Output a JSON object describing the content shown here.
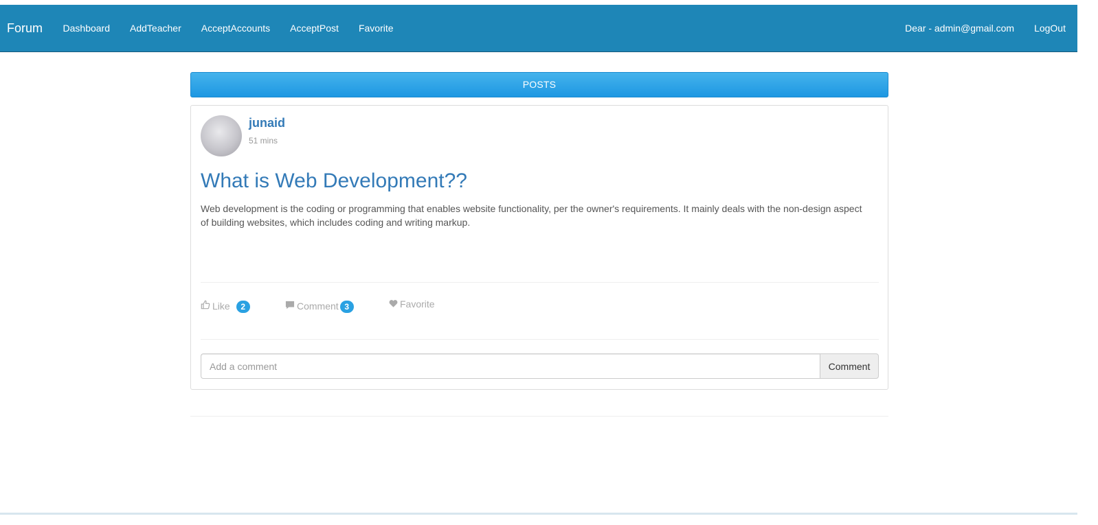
{
  "navbar": {
    "brand": "Forum",
    "links": [
      "Dashboard",
      "AddTeacher",
      "AcceptAccounts",
      "AcceptPost",
      "Favorite"
    ],
    "greeting": "Dear - admin@gmail.com",
    "logout": "LogOut",
    "color": "#1e86b7"
  },
  "posts_header": "POSTS",
  "post": {
    "author": "junaid",
    "time": "51 mins",
    "title": "What is Web Development??",
    "body": "Web development is the coding or programming that enables website functionality, per the owner's requirements. It mainly deals with the non-design aspect of building websites, which includes coding and writing markup.",
    "actions": {
      "like_label": "Like",
      "like_count": "2",
      "comment_label": "Comment",
      "comment_count": "3",
      "favorite_label": "Favorite"
    },
    "comment_box": {
      "placeholder": "Add a comment",
      "button": "Comment"
    }
  },
  "icons": {
    "like": "thumbs-up-icon",
    "comment": "comment-icon",
    "favorite": "heart-icon"
  },
  "colors": {
    "accent": "#337ab7",
    "badge": "#2aa1e2",
    "posts_bar": "#1d97e2"
  }
}
